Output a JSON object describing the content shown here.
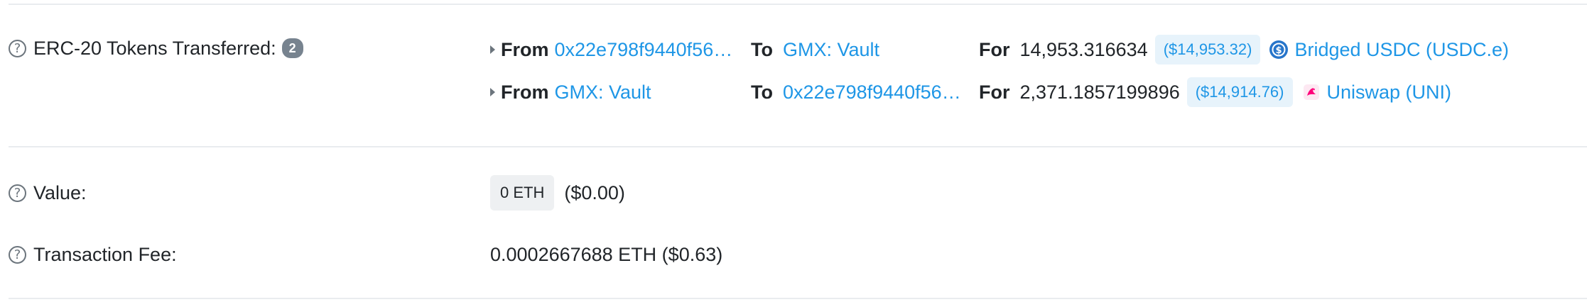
{
  "erc20": {
    "label": "ERC-20 Tokens Transferred:",
    "count": "2",
    "transfers": [
      {
        "from_kw": "From",
        "from": "0x22e798f9440f56…",
        "to_kw": "To",
        "to": "GMX: Vault",
        "for_kw": "For",
        "amount": "14,953.316634",
        "usd": "($14,953.32)",
        "token": "Bridged USDC (USDC.e)",
        "token_icon": "usdc-icon"
      },
      {
        "from_kw": "From",
        "from": "GMX: Vault",
        "to_kw": "To",
        "to": "0x22e798f9440f56…",
        "for_kw": "For",
        "amount": "2,371.1857199896",
        "usd": "($14,914.76)",
        "token": "Uniswap (UNI)",
        "token_icon": "uniswap-icon"
      }
    ]
  },
  "value": {
    "label": "Value:",
    "eth": "0 ETH",
    "usd": "($0.00)"
  },
  "fee": {
    "label": "Transaction Fee:",
    "value": "0.0002667688 ETH ($0.63)"
  },
  "colors": {
    "link": "#1e96e6",
    "pill_bg": "#e7f3fb",
    "badge_bg": "#77838f"
  }
}
